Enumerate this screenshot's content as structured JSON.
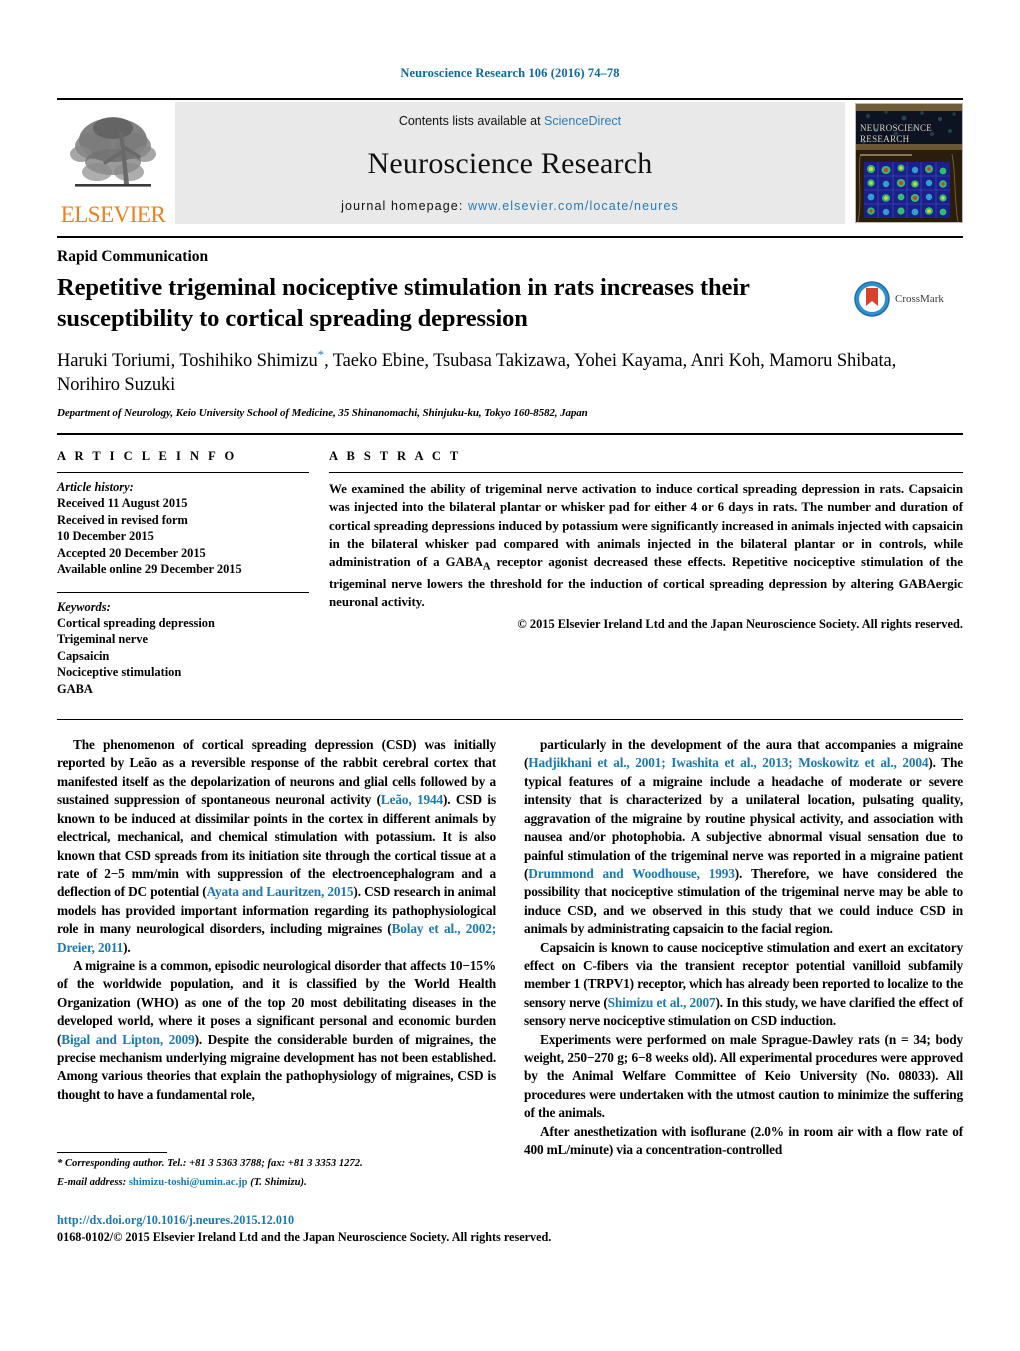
{
  "running_head": "Neuroscience Research 106 (2016) 74–78",
  "masthead": {
    "publisher_name": "ELSEVIER",
    "contents_prefix": "Contents lists available at ",
    "contents_link": "ScienceDirect",
    "journal_title": "Neuroscience Research",
    "homepage_prefix": "journal homepage: ",
    "homepage_url": "www.elsevier.com/locate/neures",
    "cover_title_line1": "NEUROSCIENCE",
    "cover_title_line2": "RESEARCH"
  },
  "article": {
    "category": "Rapid Communication",
    "title": "Repetitive trigeminal nociceptive stimulation in rats increases their susceptibility to cortical spreading depression",
    "crossmark_label": "CrossMark",
    "authors": "Haruki Toriumi, Toshihiko Shimizu",
    "authors_star": "*",
    "authors_rest": ", Taeko Ebine, Tsubasa Takizawa, Yohei Kayama, Anri Koh, Mamoru Shibata, Norihiro Suzuki",
    "affiliation": "Department of Neurology, Keio University School of Medicine, 35 Shinanomachi, Shinjuku-ku, Tokyo 160-8582, Japan"
  },
  "info": {
    "heading": "A R T I C L E    I N F O",
    "history_label": "Article history:",
    "history_lines": [
      "Received 11 August 2015",
      "Received in revised form",
      "10 December 2015",
      "Accepted 20 December 2015",
      "Available online 29 December 2015"
    ],
    "keywords_label": "Keywords:",
    "keywords": [
      "Cortical spreading depression",
      "Trigeminal nerve",
      "Capsaicin",
      "Nociceptive stimulation",
      "GABA"
    ]
  },
  "abstract": {
    "heading": "A B S T R A C T",
    "text_part1": "We examined the ability of trigeminal nerve activation to induce cortical spreading depression in rats. Capsaicin was injected into the bilateral plantar or whisker pad for either 4 or 6 days in rats. The number and duration of cortical spreading depressions induced by potassium were significantly increased in animals injected with capsaicin in the bilateral whisker pad compared with animals injected in the bilateral plantar or in controls, while administration of a GABA",
    "subscript": "A",
    "text_part2": " receptor agonist decreased these effects. Repetitive nociceptive stimulation of the trigeminal nerve lowers the threshold for the induction of cortical spreading depression by altering GABAergic neuronal activity.",
    "copyright": "© 2015 Elsevier Ireland Ltd and the Japan Neuroscience Society. All rights reserved."
  },
  "body": {
    "left": [
      {
        "segments": [
          {
            "t": "The phenomenon of cortical spreading depression (CSD) was initially reported by Leão as a reversible response of the rabbit cerebral cortex that manifested itself as the depolarization of neurons and glial cells followed by a sustained suppression of spontaneous neuronal activity (",
            "c": false
          },
          {
            "t": "Leão, 1944",
            "c": true
          },
          {
            "t": "). CSD is known to be induced at dissimilar points in the cortex in different animals by electrical, mechanical, and chemical stimulation with potassium. It is also known that CSD spreads from its initiation site through the cortical tissue at a rate of 2−5 mm/min with suppression of the electroencephalogram and a deflection of DC potential (",
            "c": false
          },
          {
            "t": "Ayata and Lauritzen, 2015",
            "c": true
          },
          {
            "t": "). CSD research in animal models has provided important information regarding its pathophysiological role in many neurological disorders, including migraines (",
            "c": false
          },
          {
            "t": "Bolay et al., 2002; Dreier, 2011",
            "c": true
          },
          {
            "t": ").",
            "c": false
          }
        ]
      },
      {
        "segments": [
          {
            "t": "A migraine is a common, episodic neurological disorder that affects 10−15% of the worldwide population, and it is classified by the World Health Organization (WHO) as one of the top 20 most debilitating diseases in the developed world, where it poses a significant personal and economic burden (",
            "c": false
          },
          {
            "t": "Bigal and Lipton, 2009",
            "c": true
          },
          {
            "t": "). Despite the considerable burden of migraines, the precise mechanism underlying migraine development has not been established. Among various theories that explain the pathophysiology of migraines, CSD is thought to have a fundamental role,",
            "c": false
          }
        ]
      }
    ],
    "right": [
      {
        "segments": [
          {
            "t": "particularly in the development of the aura that accompanies a migraine (",
            "c": false
          },
          {
            "t": "Hadjikhani et al., 2001; Iwashita et al., 2013; Moskowitz et al., 2004",
            "c": true
          },
          {
            "t": "). The typical features of a migraine include a headache of moderate or severe intensity that is characterized by a unilateral location, pulsating quality, aggravation of the migraine by routine physical activity, and association with nausea and/or photophobia. A subjective abnormal visual sensation due to painful stimulation of the trigeminal nerve was reported in a migraine patient (",
            "c": false
          },
          {
            "t": "Drummond and Woodhouse, 1993",
            "c": true
          },
          {
            "t": "). Therefore, we have considered the possibility that nociceptive stimulation of the trigeminal nerve may be able to induce CSD, and we observed in this study that we could induce CSD in animals by administrating capsaicin to the facial region.",
            "c": false
          }
        ]
      },
      {
        "segments": [
          {
            "t": "Capsaicin is known to cause nociceptive stimulation and exert an excitatory effect on C-fibers via the transient receptor potential vanilloid subfamily member 1 (TRPV1) receptor, which has already been reported to localize to the sensory nerve (",
            "c": false
          },
          {
            "t": "Shimizu et al., 2007",
            "c": true
          },
          {
            "t": "). In this study, we have clarified the effect of sensory nerve nociceptive stimulation on CSD induction.",
            "c": false
          }
        ]
      },
      {
        "segments": [
          {
            "t": "Experiments were performed on male Sprague-Dawley rats (n = 34; body weight, 250−270 g; 6−8 weeks old). All experimental procedures were approved by the Animal Welfare Committee of Keio University (No. 08033). All procedures were undertaken with the utmost caution to minimize the suffering of the animals.",
            "c": false
          }
        ]
      },
      {
        "segments": [
          {
            "t": "After anesthetization with isoflurane (2.0% in room air with a flow rate of 400 mL/minute) via a concentration-controlled",
            "c": false
          }
        ]
      }
    ]
  },
  "footnotes": {
    "corresponding_marker": "*",
    "corresponding_text": "Corresponding author. Tel.: +81 3 5363 3788; fax: +81 3 3353 1272.",
    "email_label": "E-mail address:",
    "email": "shimizu-toshi@umin.ac.jp",
    "email_suffix": "(T. Shimizu).",
    "doi": "http://dx.doi.org/10.1016/j.neures.2015.12.010",
    "issn_line": "0168-0102/© 2015 Elsevier Ireland Ltd and the Japan Neuroscience Society. All rights reserved."
  },
  "colors": {
    "link_blue": "#1a7ab0",
    "elsevier_orange": "#f07f1a",
    "banner_gray": "#e9e9e9"
  }
}
